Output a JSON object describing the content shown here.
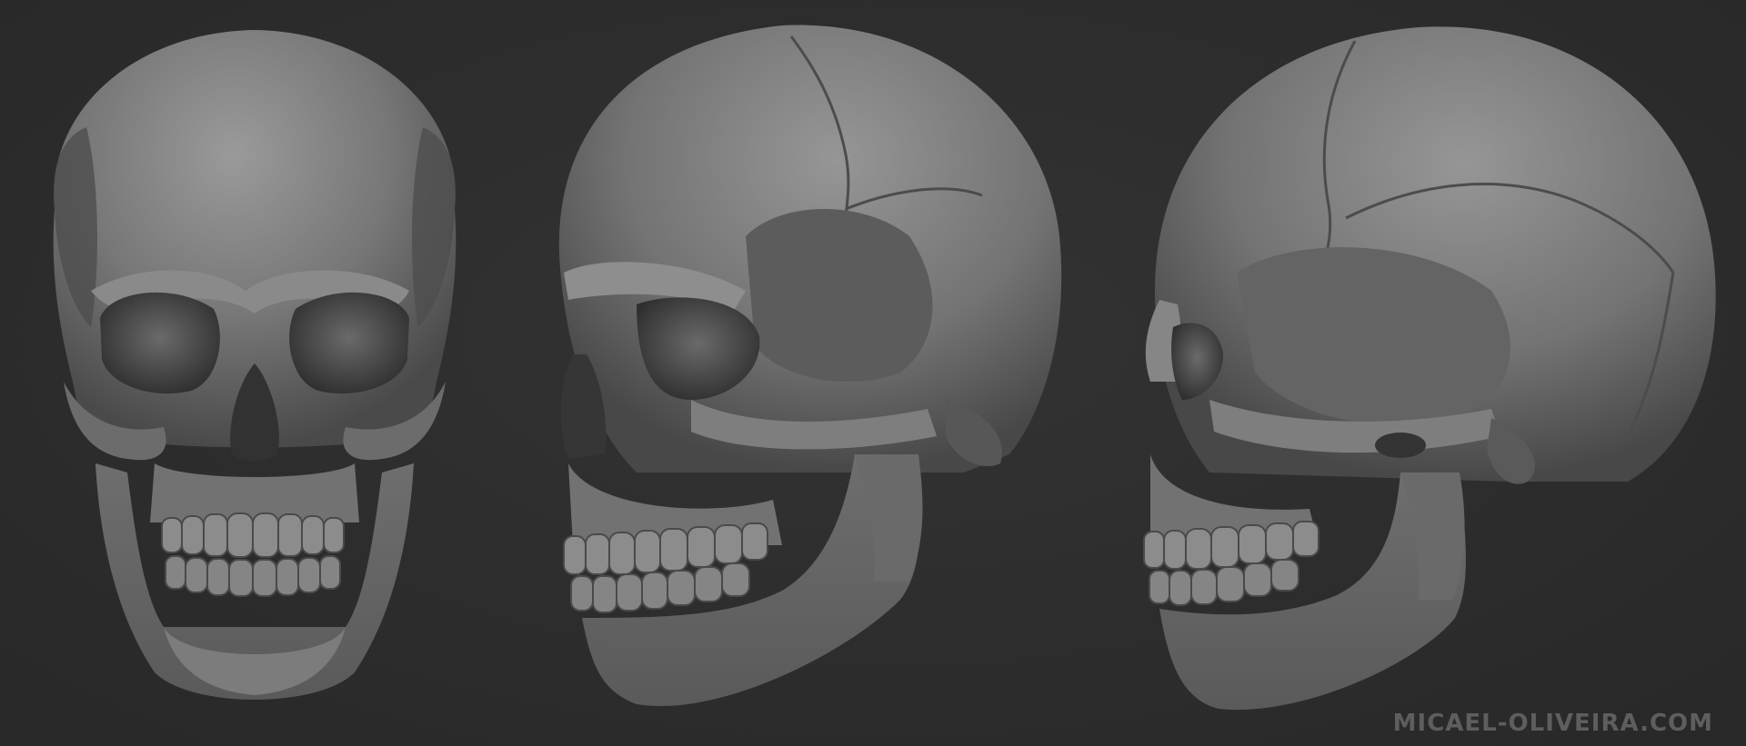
{
  "image": {
    "subject": "three views of a sculpted human skull",
    "background_color": "#2c2c2c",
    "material_color": "#7a7a7a",
    "shadow_color": "#3a3a3a",
    "highlight_color": "#a6a6a6"
  },
  "views": [
    {
      "name": "front-view"
    },
    {
      "name": "three-quarter-view"
    },
    {
      "name": "side-view"
    }
  ],
  "watermark": {
    "text": "MICAEL-OLIVEIRA.COM",
    "color": "#5e5e5e"
  }
}
